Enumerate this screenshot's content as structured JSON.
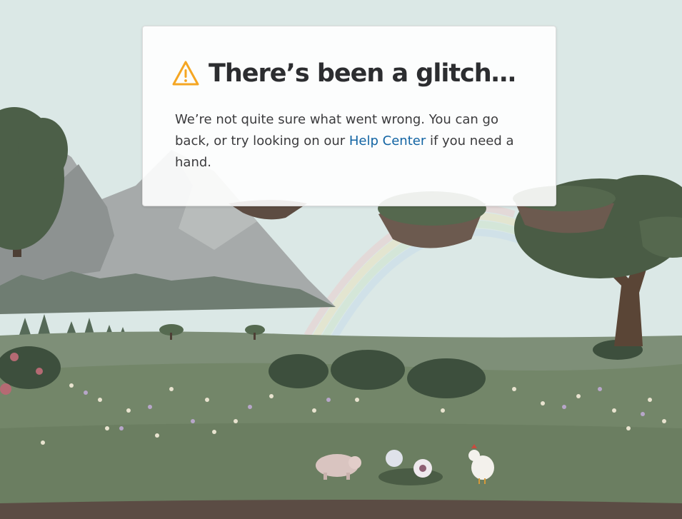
{
  "error": {
    "title": "There’s been a glitch…",
    "message_before": "We’re not quite sure what went wrong. You can go back, or try looking on our ",
    "link_text": "Help Center",
    "message_after": " if you need a hand."
  },
  "icons": {
    "warning": "warning-icon"
  },
  "colors": {
    "warning": "#f5a623",
    "link": "#1264a3",
    "title": "#2c2d30"
  }
}
